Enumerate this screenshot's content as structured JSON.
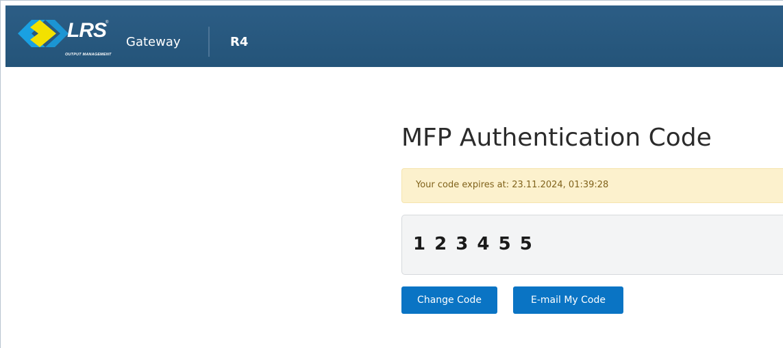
{
  "header": {
    "brand": "LRS",
    "brand_tm": "®",
    "brand_tagline": "OUTPUT MANAGEMENT",
    "product": "Gateway",
    "version": "R4"
  },
  "main": {
    "title": "MFP Authentication Code",
    "expiry_message": "Your code expires at: 23.11.2024, 01:39:28",
    "code": "1 2 3 4 5 5",
    "change_button": "Change Code",
    "email_button": "E-mail My Code"
  },
  "colors": {
    "navbar": "#245479",
    "alert_bg": "#fcf1cd",
    "alert_text": "#80621b",
    "button": "#0a74c4",
    "logo_yellow": "#f2e100",
    "logo_blue": "#1aa0e2"
  },
  "icons": {
    "logo": "lrs-double-chevron-logo"
  }
}
